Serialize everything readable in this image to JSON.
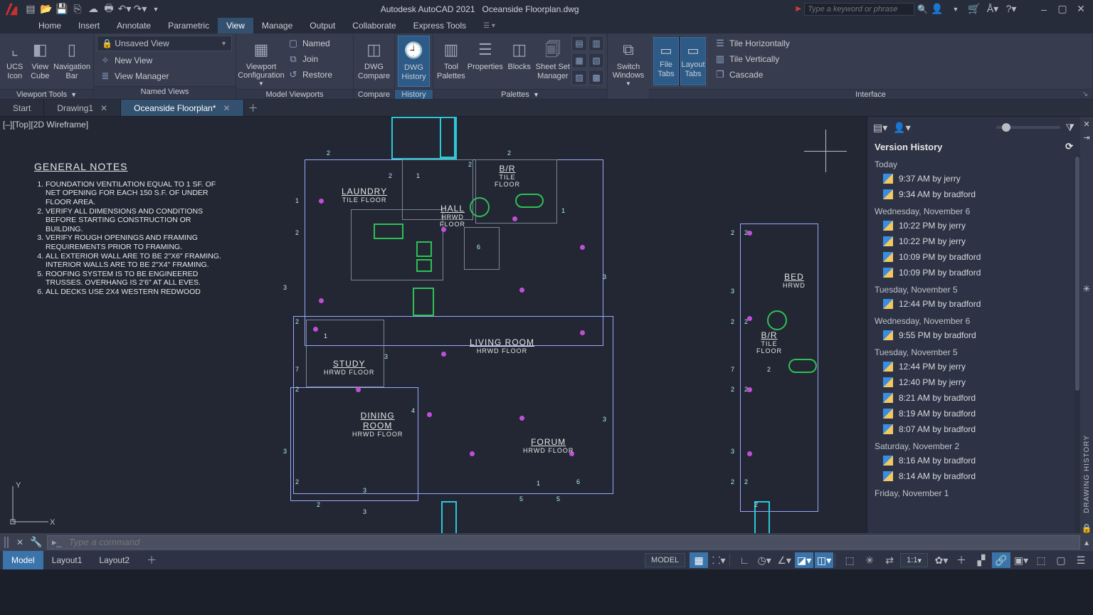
{
  "app": {
    "title": "Autodesk AutoCAD 2021",
    "document": "Oceanside Floorplan.dwg",
    "search_placeholder": "Type a keyword or phrase"
  },
  "menu": {
    "items": [
      "Home",
      "Insert",
      "Annotate",
      "Parametric",
      "View",
      "Manage",
      "Output",
      "Collaborate",
      "Express Tools"
    ],
    "active": "View"
  },
  "ribbon": {
    "viewport_tools": {
      "label": "Viewport Tools",
      "ucs": "UCS\nIcon",
      "viewcube": "View\nCube",
      "nav": "Navigation\nBar"
    },
    "named_views": {
      "label": "Named Views",
      "combo": "Unsaved View",
      "new_view": "New View",
      "view_manager": "View Manager",
      "vp_config": "Viewport\nConfiguration",
      "named": "Named",
      "join": "Join",
      "restore": "Restore"
    },
    "model_viewports": {
      "label": "Model Viewports"
    },
    "compare": {
      "label": "Compare",
      "dwg_compare": "DWG\nCompare"
    },
    "history": {
      "label": "History",
      "dwg_history": "DWG\nHistory"
    },
    "palettes": {
      "label": "Palettes",
      "tool": "Tool\nPalettes",
      "props": "Properties",
      "blocks": "Blocks",
      "sheet": "Sheet Set\nManager"
    },
    "switch": {
      "label": "Switch\nWindows"
    },
    "interface": {
      "label": "Interface",
      "file_tabs": "File\nTabs",
      "layout_tabs": "Layout\nTabs",
      "tile_h": "Tile Horizontally",
      "tile_v": "Tile Vertically",
      "cascade": "Cascade"
    }
  },
  "doctabs": {
    "tabs": [
      {
        "label": "Start",
        "close": false
      },
      {
        "label": "Drawing1",
        "close": true
      },
      {
        "label": "Oceanside Floorplan*",
        "close": true
      }
    ],
    "active": 2
  },
  "viewport_label": "[–][Top][2D Wireframe]",
  "notes": {
    "title": "GENERAL NOTES",
    "items": [
      "FOUNDATION VENTILATION EQUAL TO 1 SF. OF NET OPENING FOR EACH 150 S.F. OF UNDER FLOOR AREA.",
      "VERIFY ALL DIMENSIONS AND CONDITIONS BEFORE STARTING CONSTRUCTION OR BUILDING.",
      "VERIFY ROUGH OPENINGS AND FRAMING REQUIREMENTS PRIOR TO FRAMING.",
      "ALL EXTERIOR WALL ARE TO BE 2\"X6\" FRAMING. INTERIOR WALLS ARE TO BE 2\"X4\" FRAMING.",
      "ROOFING SYSTEM IS TO BE ENGINEERED TRUSSES. OVERHANG IS 2'6\" AT ALL EVES.",
      "ALL DECKS USE 2X4 WESTERN REDWOOD"
    ]
  },
  "rooms": {
    "laundry": {
      "name": "LAUNDRY",
      "floor": "TILE FLOOR"
    },
    "br1": {
      "name": "B/R",
      "floor": "TILE\nFLOOR"
    },
    "hall": {
      "name": "HALL",
      "floor": "HRWD\nFLOOR"
    },
    "living": {
      "name": "LIVING ROOM",
      "floor": "HRWD FLOOR"
    },
    "study": {
      "name": "STUDY",
      "floor": "HRWD FLOOR"
    },
    "dining": {
      "name": "DINING\nROOM",
      "floor": "HRWD FLOOR"
    },
    "forum": {
      "name": "FORUM",
      "floor": "HRWD FLOOR"
    },
    "bed": {
      "name": "BED",
      "floor": "HRWD"
    },
    "br2": {
      "name": "B/R",
      "floor": "TILE\nFLOOR"
    }
  },
  "version_panel": {
    "title": "Version History",
    "vtab": "DRAWING HISTORY",
    "groups": [
      {
        "label": "Today",
        "items": [
          "9:37 AM by jerry",
          "9:34 AM by bradford"
        ]
      },
      {
        "label": "Wednesday, November 6",
        "items": [
          "10:22 PM by jerry",
          "10:22 PM by jerry",
          "10:09 PM by bradford",
          "10:09 PM by bradford"
        ]
      },
      {
        "label": "Tuesday, November 5",
        "items": [
          "12:44 PM by bradford"
        ]
      },
      {
        "label": "Wednesday, November 6",
        "items": [
          "9:55 PM by bradford"
        ]
      },
      {
        "label": "Tuesday, November 5",
        "items": [
          "12:44 PM by jerry",
          "12:40 PM by jerry",
          "8:21 AM by bradford",
          "8:19 AM by bradford",
          "8:07 AM by bradford"
        ]
      },
      {
        "label": "Saturday, November 2",
        "items": [
          "8:16 AM by bradford",
          "8:14 AM by bradford"
        ]
      },
      {
        "label": "Friday, November 1",
        "items": []
      }
    ]
  },
  "command": {
    "prompt": "▸_",
    "placeholder": "Type a command"
  },
  "status": {
    "tabs": [
      "Model",
      "Layout1",
      "Layout2"
    ],
    "active": 0,
    "model_btn": "MODEL",
    "scale": "1:1"
  }
}
